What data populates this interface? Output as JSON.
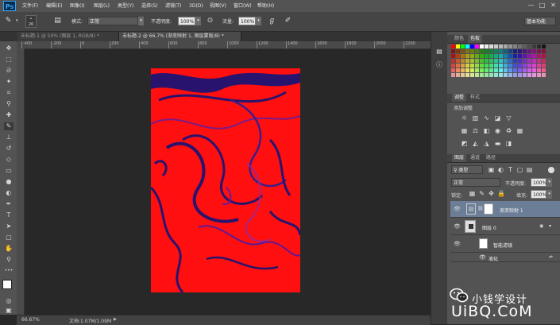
{
  "app": {
    "logo": "Ps",
    "menus": [
      "文件(F)",
      "编辑(E)",
      "图像(I)",
      "图层(L)",
      "类型(Y)",
      "选择(S)",
      "滤镜(T)",
      "3D(D)",
      "视图(V)",
      "窗口(W)",
      "帮助(H)"
    ],
    "window_controls": [
      "—",
      "□",
      "✕"
    ]
  },
  "options": {
    "brush_size": "26",
    "mode_label": "模式:",
    "mode_value": "正常",
    "opacity_label": "不透明度:",
    "opacity_value": "100%",
    "flow_label": "流量:",
    "flow_value": "100%",
    "workspace": "基本功能"
  },
  "tabs": [
    {
      "label": "未标题-1 @ 50% (图层 1, RGB/8) *",
      "active": false
    },
    {
      "label": "未标题-2 @ 66.7% (渐变映射 1, 图层蒙版/8) *",
      "active": true
    }
  ],
  "ruler": {
    "top_labels": [
      "-400",
      "-200",
      "0",
      "200",
      "400",
      "600",
      "800",
      "1000",
      "1200",
      "1400",
      "1600",
      "1800",
      "2000",
      "2200"
    ]
  },
  "status": {
    "zoom": "66.67%",
    "doc": "文档:1.07M/1.09M"
  },
  "panels": {
    "swatches": {
      "tab1": "颜色",
      "tab2": "色板"
    },
    "adjustments": {
      "tab1": "调整",
      "tab2": "样式",
      "title": "添加调整"
    },
    "layers": {
      "tabs": [
        "图层",
        "通道",
        "路径"
      ],
      "filter_label": "类型",
      "blend_mode": "正常",
      "opacity_label": "不透明度:",
      "opacity_value": "100%",
      "lock_label": "锁定:",
      "fill_label": "填充:",
      "fill_value": "100%",
      "items": [
        {
          "name": "渐变映射 1",
          "selected": true
        },
        {
          "name": "图层 0",
          "selected": false
        },
        {
          "name": "智能滤镜",
          "selected": false
        },
        {
          "name": "液化",
          "selected": false
        }
      ]
    }
  },
  "watermark": {
    "cn": "小钱学设计",
    "en": "UiBQ.CoM"
  },
  "colors": {
    "art_red": "#ff0f0f",
    "art_blue": "#28146e",
    "selection": "#6b7d97"
  },
  "icons": {
    "toolbar": [
      "move-icon",
      "marquee-icon",
      "lasso-icon",
      "quick-select-icon",
      "crop-icon",
      "eyedropper-icon",
      "healing-icon",
      "brush-icon",
      "clone-stamp-icon",
      "history-brush-icon",
      "eraser-icon",
      "gradient-icon",
      "blur-icon",
      "dodge-icon",
      "pen-icon",
      "type-icon",
      "path-select-icon",
      "shape-icon",
      "hand-icon",
      "zoom-icon"
    ]
  }
}
